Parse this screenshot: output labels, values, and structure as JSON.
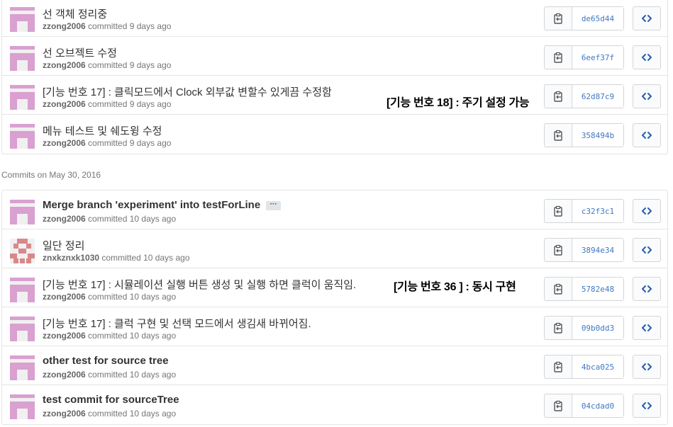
{
  "group1": {
    "commits": [
      {
        "title": "선 객체 정리중",
        "author": "zzong2006",
        "action": "committed",
        "time": "9 days ago",
        "sha": "de65d44"
      },
      {
        "title": "선 오브젝트 수정",
        "author": "zzong2006",
        "action": "committed",
        "time": "9 days ago",
        "sha": "6eef37f"
      },
      {
        "title": "[기능 번호 17] : 클릭모드에서 Clock 외부값 변할수 있게끔 수정함",
        "author": "zzong2006",
        "action": "committed",
        "time": "9 days ago",
        "sha": "62d87c9"
      },
      {
        "title": "메뉴 테스트 및 쉐도윙 수정",
        "author": "zzong2006",
        "action": "committed",
        "time": "9 days ago",
        "sha": "358494b"
      }
    ]
  },
  "date_header": "Commits on May 30, 2016",
  "group2": {
    "commits": [
      {
        "title": "Merge branch 'experiment' into testForLine",
        "author": "zzong2006",
        "action": "committed",
        "time": "10 days ago",
        "sha": "c32f3c1",
        "more": "···"
      },
      {
        "title": "일단 정리",
        "author": "znxkznxk1030",
        "action": "committed",
        "time": "10 days ago",
        "sha": "3894e34"
      },
      {
        "title": "[기능 번호 17] : 시뮬레이션 실행 버튼 생성 및 실행 하면 클럭이 움직임.",
        "author": "zzong2006",
        "action": "committed",
        "time": "10 days ago",
        "sha": "5782e48"
      },
      {
        "title": "[기능 번호 17] : 클럭 구현 및 선택 모드에서 생김새 바뀌어짐.",
        "author": "zzong2006",
        "action": "committed",
        "time": "10 days ago",
        "sha": "09b0dd3"
      },
      {
        "title": "other test for source tree",
        "author": "zzong2006",
        "action": "committed",
        "time": "10 days ago",
        "sha": "4bca025"
      },
      {
        "title": "test commit for sourceTree",
        "author": "zzong2006",
        "action": "committed",
        "time": "10 days ago",
        "sha": "04cdad0"
      }
    ]
  },
  "annotations": {
    "a1": "[기능 번호 18] : 주기 설정 가능",
    "a2": "[기능 번호 36 ] : 동시 구현"
  },
  "icons": {
    "copy": "clippy-icon",
    "browse": "code-icon"
  },
  "colors": {
    "avatar_pink": "#d9a0d0",
    "avatar_red": "#d9888a",
    "sha_blue": "#4078c0",
    "border": "#e5e5e5"
  }
}
